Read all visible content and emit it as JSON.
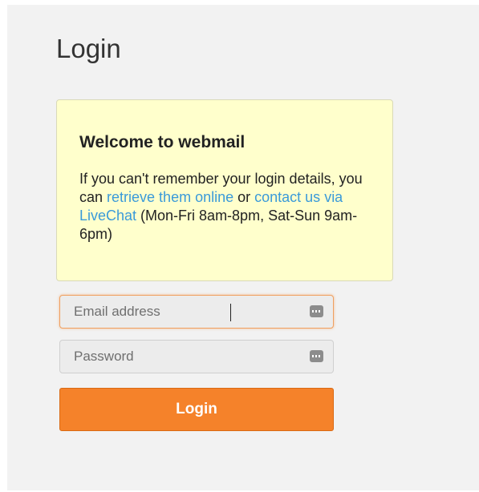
{
  "page": {
    "title": "Login"
  },
  "notice": {
    "title": "Welcome to webmail",
    "text_before": "If you can't remember your login details, you can ",
    "link_retrieve": "retrieve them online",
    "text_middle": " or ",
    "link_livechat": "contact us via LiveChat",
    "text_after": " (Mon-Fri 8am-8pm, Sat-Sun 9am-6pm)"
  },
  "form": {
    "email": {
      "placeholder": "Email address",
      "value": ""
    },
    "password": {
      "placeholder": "Password",
      "value": ""
    },
    "submit_label": "Login"
  },
  "icons": {
    "field_icon": "password-manager-key-icon"
  },
  "colors": {
    "accent": "#f5822a",
    "notice_background": "#ffffcc",
    "link": "#3a9ad9",
    "panel_background": "#f2f2f2"
  }
}
